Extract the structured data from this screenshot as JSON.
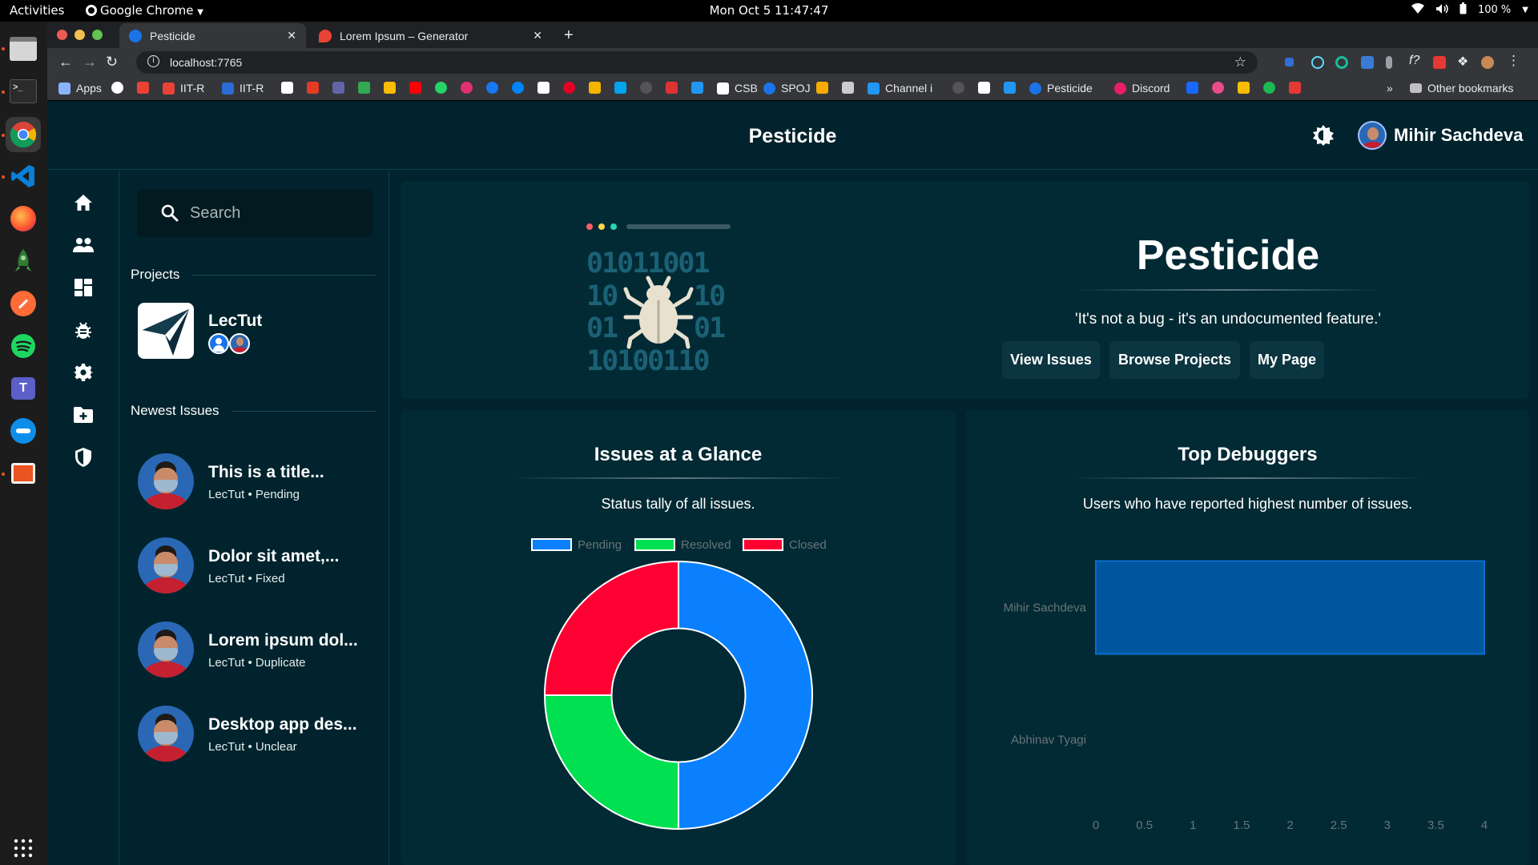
{
  "system_bar": {
    "activities": "Activities",
    "app_menu": "Google Chrome",
    "clock": "Mon Oct 5  11:47:47",
    "battery": "100 %"
  },
  "browser": {
    "tabs": [
      {
        "title": "Pesticide",
        "favicon_color": "#1a73e8"
      },
      {
        "title": "Lorem Ipsum – Generator",
        "favicon_color": "#ea4335"
      }
    ],
    "new_tab": "+",
    "url": "localhost:7765",
    "bookmarks": [
      {
        "label": "Apps",
        "icon": "apps-grid-icon",
        "color": "#8ab4f8"
      },
      {
        "label": "",
        "icon": "google-icon",
        "color": "#ffffff"
      },
      {
        "label": "",
        "icon": "gmail-icon",
        "color": "#ea4335"
      },
      {
        "label": "IIT-R",
        "icon": "gmail-icon",
        "color": "#ea4335"
      },
      {
        "label": "IIT-R",
        "icon": "iitr-icon",
        "color": "#2b6cd7"
      },
      {
        "label": "",
        "icon": "telegram-icon",
        "color": "#ffffff"
      },
      {
        "label": "",
        "icon": "office-icon",
        "color": "#e43b25"
      },
      {
        "label": "",
        "icon": "teams-icon",
        "color": "#6264a7"
      },
      {
        "label": "",
        "icon": "drive-icon",
        "color": "#34a853"
      },
      {
        "label": "",
        "icon": "keep-icon",
        "color": "#fbbc04"
      },
      {
        "label": "",
        "icon": "youtube-icon",
        "color": "#ff0000"
      },
      {
        "label": "",
        "icon": "whatsapp-icon",
        "color": "#25d366"
      },
      {
        "label": "",
        "icon": "instagram-icon",
        "color": "#e1306c"
      },
      {
        "label": "",
        "icon": "facebook-icon",
        "color": "#1877f2"
      },
      {
        "label": "",
        "icon": "messenger-icon",
        "color": "#0084ff"
      },
      {
        "label": "",
        "icon": "amazon-icon",
        "color": "#ffffff"
      },
      {
        "label": "",
        "icon": "pinterest-icon",
        "color": "#e60023"
      },
      {
        "label": "",
        "icon": "sheets-icon",
        "color": "#f4b400"
      },
      {
        "label": "",
        "icon": "microsoft-icon",
        "color": "#00a4ef"
      },
      {
        "label": "",
        "icon": "github-icon",
        "color": "#555555"
      },
      {
        "label": "",
        "icon": "codechef-icon",
        "color": "#d33"
      },
      {
        "label": "",
        "icon": "box-icon",
        "color": "#2196f3"
      },
      {
        "label": "CSB",
        "icon": "codesandbox-icon",
        "color": "#ffffff"
      },
      {
        "label": "SPOJ",
        "icon": "spoj-icon",
        "color": "#1a73e8"
      },
      {
        "label": "",
        "icon": "analytics-icon",
        "color": "#f9ab00"
      },
      {
        "label": "",
        "icon": "cc-icon",
        "color": "#cccccc"
      },
      {
        "label": "Channel i",
        "icon": "channel-icon",
        "color": "#2196f3"
      },
      {
        "label": "",
        "icon": "github2-icon",
        "color": "#555555"
      },
      {
        "label": "",
        "icon": "devto-icon",
        "color": "#ffffff"
      },
      {
        "label": "",
        "icon": "freecodecamp-icon",
        "color": "#2196f3"
      },
      {
        "label": "Pesticide",
        "icon": "pesticide-icon",
        "color": "#1a73e8"
      },
      {
        "label": "Discord",
        "icon": "discord-icon",
        "color": "#e91e63"
      },
      {
        "label": "",
        "icon": "behance-icon",
        "color": "#1769ff"
      },
      {
        "label": "",
        "icon": "dribbble-icon",
        "color": "#ea4c89"
      },
      {
        "label": "",
        "icon": "slides-icon",
        "color": "#fbbc04"
      },
      {
        "label": "",
        "icon": "spotify-icon",
        "color": "#1db954"
      },
      {
        "label": "",
        "icon": "unsplash-icon",
        "color": "#e53935"
      }
    ],
    "more_bookmarks": "»",
    "other_bookmarks": "Other bookmarks"
  },
  "app": {
    "title": "Pesticide",
    "user_name": "Mihir Sachdeva",
    "search_placeholder": "Search",
    "projects_heading": "Projects",
    "project": {
      "name": "LecTut"
    },
    "issues_heading": "Newest Issues",
    "issues": [
      {
        "title": "This is a title...",
        "project": "LecTut",
        "status": "Pending"
      },
      {
        "title": "Dolor sit amet,...",
        "project": "LecTut",
        "status": "Fixed"
      },
      {
        "title": "Lorem ipsum dol...",
        "project": "LecTut",
        "status": "Duplicate"
      },
      {
        "title": "Desktop app des...",
        "project": "LecTut",
        "status": "Unclear"
      }
    ],
    "meta_sep": "•",
    "hero": {
      "title": "Pesticide",
      "quote": "'It's not a bug - it's an undocumented feature.'",
      "buttons": [
        "View Issues",
        "Browse Projects",
        "My Page"
      ],
      "illustration_rows": [
        "01011001",
        "10",
        "10",
        "01",
        "01",
        "10100110"
      ]
    }
  },
  "chart_data": [
    {
      "type": "pie",
      "title": "Issues at a Glance",
      "subtitle": "Status tally of all issues.",
      "categories": [
        "Pending",
        "Resolved",
        "Closed"
      ],
      "values": [
        2,
        1,
        1
      ],
      "colors": [
        "#0a80ff",
        "#00e050",
        "#ff0033"
      ],
      "hole": 0.5,
      "legend": "top"
    },
    {
      "type": "bar",
      "orientation": "horizontal",
      "title": "Top Debuggers",
      "subtitle": "Users who have reported highest number of issues.",
      "categories": [
        "Mihir Sachdeva",
        "Abhinav Tyagi"
      ],
      "values": [
        4,
        0
      ],
      "xlim": [
        0,
        4
      ],
      "xticks": [
        "0",
        "0.5",
        "1",
        "1.5",
        "2",
        "2.5",
        "3",
        "3.5",
        "4"
      ],
      "color": "#00569e"
    }
  ]
}
